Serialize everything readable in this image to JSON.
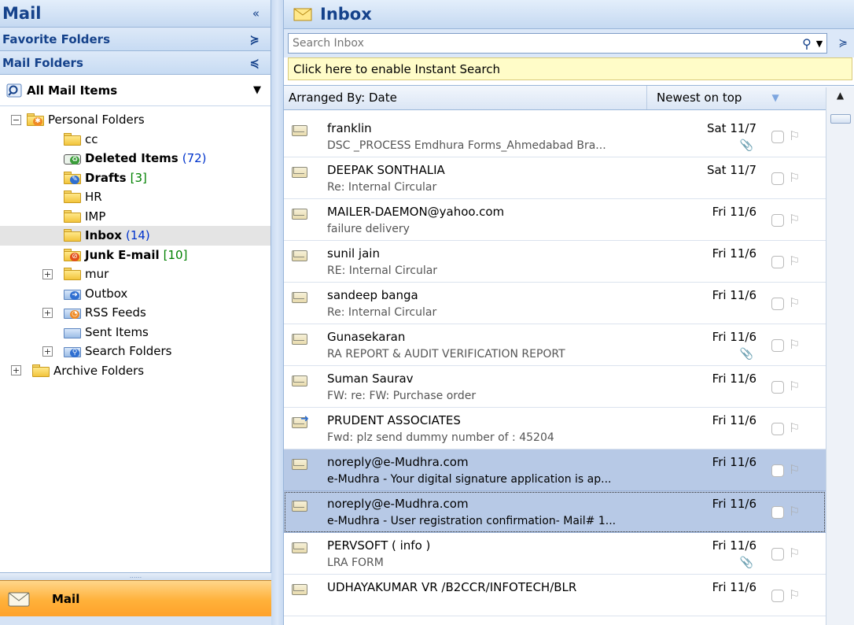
{
  "nav": {
    "title": "Mail",
    "collapse_glyph": "«",
    "favorite_folders": "Favorite Folders",
    "favorite_chevron": "≽",
    "mail_folders": "Mail Folders",
    "mail_folders_chevron": "≼",
    "all_mail_items": "All Mail Items",
    "dropdown_glyph": "▼",
    "folders": [
      {
        "label": "Personal Folders",
        "count": ""
      },
      {
        "label": "cc",
        "count": ""
      },
      {
        "label": "Deleted Items",
        "count": "(72)"
      },
      {
        "label": "Drafts",
        "count": "[3]"
      },
      {
        "label": "HR",
        "count": ""
      },
      {
        "label": "IMP",
        "count": ""
      },
      {
        "label": "Inbox",
        "count": "(14)"
      },
      {
        "label": "Junk E-mail",
        "count": "[10]"
      },
      {
        "label": "mur",
        "count": ""
      },
      {
        "label": "Outbox",
        "count": ""
      },
      {
        "label": "RSS Feeds",
        "count": ""
      },
      {
        "label": "Sent Items",
        "count": ""
      },
      {
        "label": "Search Folders",
        "count": ""
      },
      {
        "label": "Archive Folders",
        "count": ""
      }
    ],
    "expand_plus": "⊞",
    "expand_minus": "⊟",
    "grip": "......",
    "mail_button": "Mail"
  },
  "inbox": {
    "title": "Inbox",
    "search_placeholder": "Search Inbox",
    "search_icon": "⚲",
    "search_dropdown": "▼",
    "search_chevron": "≽",
    "instant_search": "Click here to enable Instant Search",
    "arranged_by": "Arranged By: Date",
    "sort_order": "Newest on top",
    "sort_glyph": "▼",
    "scroll_up": "▲",
    "flag_glyph": "⚐",
    "clip_glyph": "📎",
    "messages": [
      {
        "sender": "franklin",
        "subject": "DSC _PROCESS Emdhura Forms_Ahmedabad Bra...",
        "date": "Sat 11/7",
        "attachment": true
      },
      {
        "sender": "DEEPAK SONTHALIA",
        "subject": "Re: Internal Circular",
        "date": "Sat 11/7",
        "attachment": false
      },
      {
        "sender": "MAILER-DAEMON@yahoo.com",
        "subject": "failure delivery",
        "date": "Fri 11/6",
        "attachment": false
      },
      {
        "sender": "sunil jain",
        "subject": "RE: Internal Circular",
        "date": "Fri 11/6",
        "attachment": false
      },
      {
        "sender": "sandeep  banga",
        "subject": "Re: Internal Circular",
        "date": "Fri 11/6",
        "attachment": false
      },
      {
        "sender": "Gunasekaran",
        "subject": "RA REPORT & AUDIT VERIFICATION REPORT",
        "date": "Fri 11/6",
        "attachment": true
      },
      {
        "sender": "Suman Saurav",
        "subject": "FW: re: FW: Purchase order",
        "date": "Fri 11/6",
        "attachment": false
      },
      {
        "sender": "PRUDENT ASSOCIATES",
        "subject": "Fwd: plz send dummy number of : 45204",
        "date": "Fri 11/6",
        "attachment": false
      },
      {
        "sender": "noreply@e-Mudhra.com",
        "subject": "e-Mudhra - Your digital signature application is ap...",
        "date": "Fri 11/6",
        "attachment": false
      },
      {
        "sender": "noreply@e-Mudhra.com",
        "subject": "e-Mudhra - User registration confirmation- Mail# 1...",
        "date": "Fri 11/6",
        "attachment": false
      },
      {
        "sender": "PERVSOFT ( info )",
        "subject": "LRA FORM",
        "date": "Fri 11/6",
        "attachment": true
      },
      {
        "sender": "UDHAYAKUMAR VR      /B2CCR/INFOTECH/BLR",
        "subject": "",
        "date": "Fri 11/6",
        "attachment": false
      }
    ]
  }
}
